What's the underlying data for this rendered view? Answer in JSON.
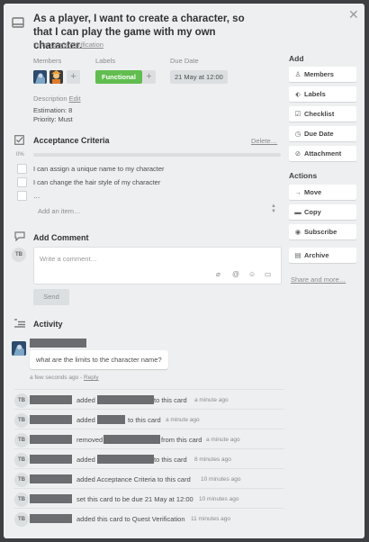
{
  "card": {
    "title": "As a player, I want to create a character, so that I can play the game with my own character.",
    "in_list_prefix": "in list",
    "list_name": "Quest Verification",
    "close_glyph": "✕"
  },
  "meta": {
    "members_label": "Members",
    "labels_label": "Labels",
    "due_label": "Due Date",
    "label_name": "Functional",
    "label_color": "#61bd4f",
    "due_value": "21 May at 12:00",
    "plus_glyph": "+"
  },
  "description": {
    "label": "Description",
    "edit": "Edit",
    "line1": "Estimation: 8",
    "line2": "Priority: Must"
  },
  "checklist": {
    "title": "Acceptance Criteria",
    "delete": "Delete…",
    "percent": "0%",
    "items": [
      "I can assign a unique name to my character",
      "I can change the hair style of my character",
      "…"
    ],
    "add_item": "Add an item…"
  },
  "comment": {
    "title": "Add Comment",
    "initials": "TB",
    "placeholder": "Write a comment…",
    "send": "Send"
  },
  "activity": {
    "title": "Activity",
    "comment_text": "what are the limits to the character name?",
    "comment_time": "a few seconds ago",
    "reply": "Reply",
    "sep": "-",
    "rows": [
      {
        "initials": "TB",
        "verb": "added",
        "tail": "to this card",
        "time": "a minute ago"
      },
      {
        "initials": "TB",
        "verb": "added",
        "tail": "to this card",
        "time": "a minute ago"
      },
      {
        "initials": "TB",
        "verb": "removed",
        "tail": "from this card",
        "time": "a minute ago"
      },
      {
        "initials": "TB",
        "verb": "added",
        "tail": "to this card",
        "time": "8 minutes ago"
      },
      {
        "initials": "TB",
        "verb": "",
        "tail": "added Acceptance Criteria to this card",
        "time": "10 minutes ago"
      },
      {
        "initials": "TB",
        "verb": "",
        "tail": "set this card to be due 21 May at 12:00",
        "time": "10 minutes ago"
      },
      {
        "initials": "TB",
        "verb": "",
        "tail": "added this card to Quest Verification",
        "time": "11 minutes ago"
      }
    ]
  },
  "sidebar": {
    "add_heading": "Add",
    "actions_heading": "Actions",
    "add_buttons": [
      "Members",
      "Labels",
      "Checklist",
      "Due Date",
      "Attachment"
    ],
    "action_buttons": [
      "Move",
      "Copy",
      "Subscribe",
      "Archive"
    ],
    "share": "Share and more…"
  }
}
